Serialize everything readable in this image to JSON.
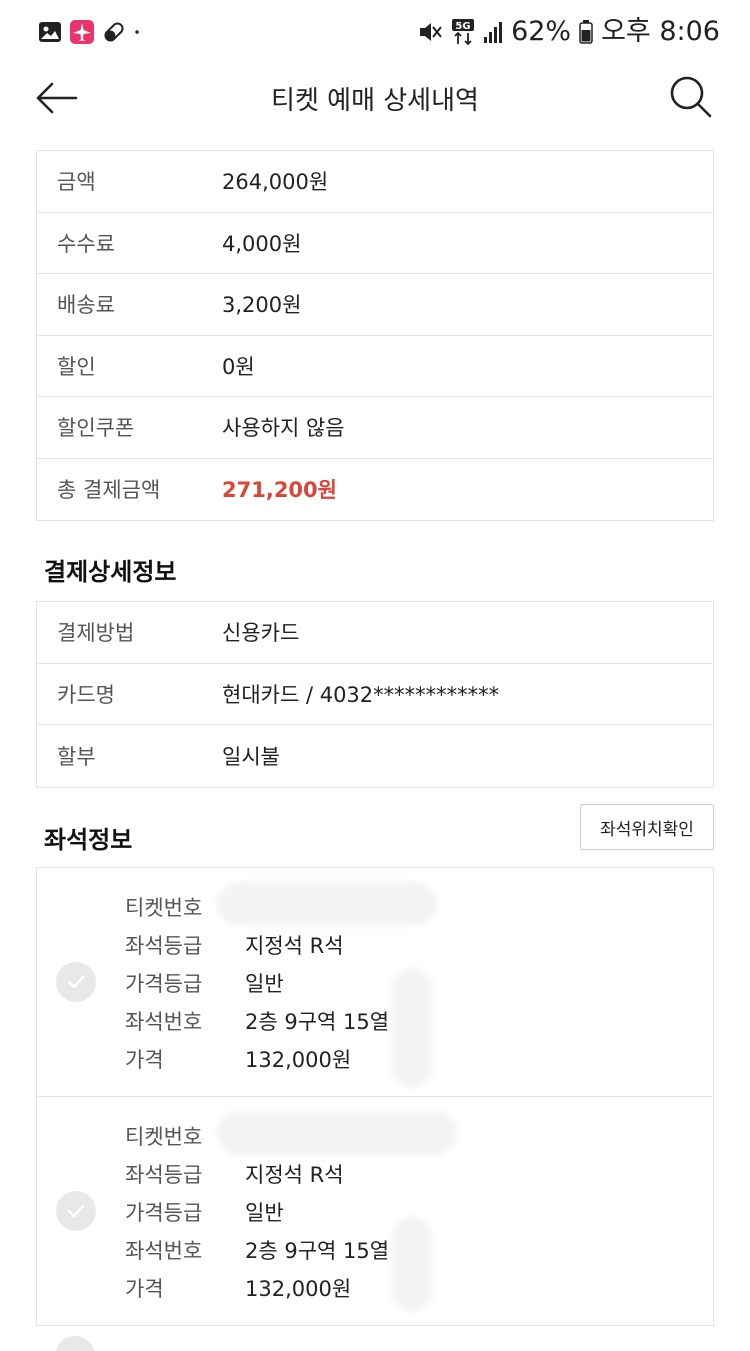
{
  "status_bar": {
    "battery_percent": "62%",
    "time": "오후 8:06",
    "network": "5G",
    "icons_left": [
      "gallery-icon",
      "airplane-app-icon",
      "pill-icon",
      "dot-icon"
    ],
    "icons_right": [
      "mute-icon",
      "network-5g-icon",
      "signal-icon",
      "battery-icon"
    ]
  },
  "header": {
    "title": "티켓 예매 상세내역"
  },
  "payment_summary": {
    "rows": [
      {
        "label": "금액",
        "value": "264,000원"
      },
      {
        "label": "수수료",
        "value": "4,000원"
      },
      {
        "label": "배송료",
        "value": "3,200원"
      },
      {
        "label": "할인",
        "value": "0원"
      },
      {
        "label": "할인쿠폰",
        "value": "사용하지 않음"
      },
      {
        "label": "총 결제금액",
        "value": "271,200원"
      }
    ]
  },
  "payment_detail": {
    "title": "결제상세정보",
    "rows": [
      {
        "label": "결제방법",
        "value": "신용카드"
      },
      {
        "label": "카드명",
        "value": "현대카드 / 4032************"
      },
      {
        "label": "할부",
        "value": "일시불"
      }
    ]
  },
  "seat_info": {
    "title": "좌석정보",
    "location_button": "좌석위치확인",
    "tickets": [
      {
        "ticket_no_label": "티켓번호",
        "grade_label": "좌석등급",
        "grade_value": "지정석 R석",
        "price_grade_label": "가격등급",
        "price_grade_value": "일반",
        "seat_no_label": "좌석번호",
        "seat_no_value": "2층 9구역 15열",
        "price_label": "가격",
        "price_value": "132,000원"
      },
      {
        "ticket_no_label": "티켓번호",
        "grade_label": "좌석등급",
        "grade_value": "지정석 R석",
        "price_grade_label": "가격등급",
        "price_grade_value": "일반",
        "seat_no_label": "좌석번호",
        "seat_no_value": "2층 9구역 15열",
        "price_label": "가격",
        "price_value": "132,000원"
      }
    ]
  },
  "colors": {
    "accent_total": "#d9463a",
    "border": "#e3e3e3",
    "check_bg": "#e8e8e8"
  }
}
